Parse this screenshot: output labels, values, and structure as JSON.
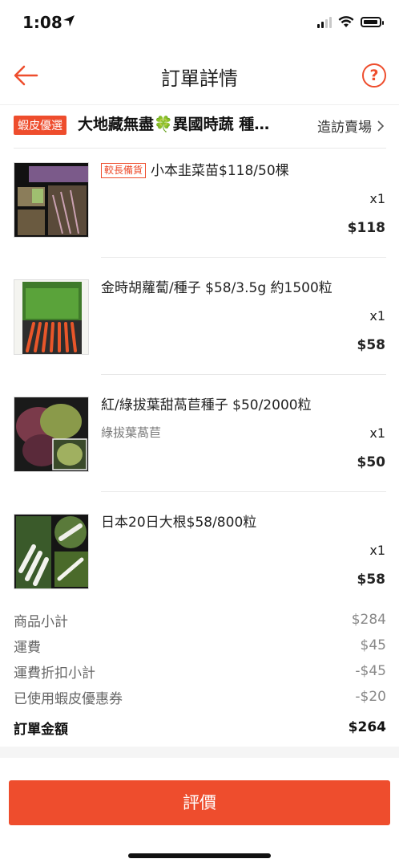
{
  "status_bar": {
    "time": "1:08"
  },
  "header": {
    "title": "訂單詳情"
  },
  "shop": {
    "badge": "蝦皮優選",
    "name": "大地藏無盡🍀異國時蔬 種…",
    "visit_label": "造訪賣場"
  },
  "items": [
    {
      "tag": "較長備貨",
      "title": "小本韭菜苗$118/50棵",
      "variant": "",
      "qty": "x1",
      "price": "$118"
    },
    {
      "tag": "",
      "title": "金時胡蘿蔔/種子 $58/3.5g 約1500粒",
      "variant": "",
      "qty": "x1",
      "price": "$58"
    },
    {
      "tag": "",
      "title": "紅/綠拔葉甜萵苣種子 $50/2000粒",
      "variant": "綠拔葉萵苣",
      "qty": "x1",
      "price": "$50"
    },
    {
      "tag": "",
      "title": "日本20日大根$58/800粒",
      "variant": "",
      "qty": "x1",
      "price": "$58"
    }
  ],
  "summary": [
    {
      "label": "商品小計",
      "value": "$284"
    },
    {
      "label": "運費",
      "value": "$45"
    },
    {
      "label": "運費折扣小計",
      "value": "-$45"
    },
    {
      "label": "已使用蝦皮優惠券",
      "value": "-$20"
    }
  ],
  "total": {
    "label": "訂單金額",
    "value": "$264"
  },
  "cta": {
    "label": "評價"
  },
  "colors": {
    "accent": "#ee4d2d",
    "text": "#222222",
    "muted": "#888888"
  }
}
